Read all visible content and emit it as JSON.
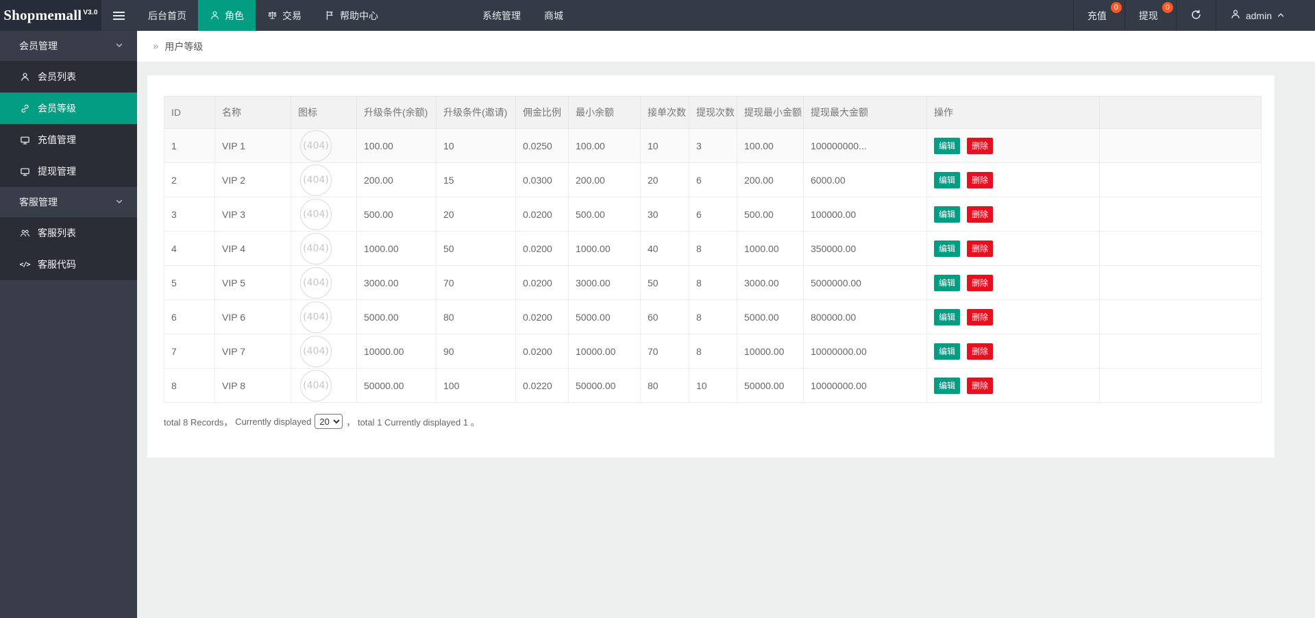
{
  "brand": {
    "name": "Shopmemall",
    "version": "V3.0"
  },
  "topnav": {
    "items": [
      {
        "label": "后台首页",
        "icon": null,
        "active": false
      },
      {
        "label": "角色",
        "icon": "person",
        "active": true
      },
      {
        "label": "交易",
        "icon": "scales",
        "active": false
      },
      {
        "label": "帮助中心",
        "icon": "flag",
        "active": false
      },
      {
        "label": "系统管理",
        "icon": null,
        "active": false
      },
      {
        "label": "商城",
        "icon": null,
        "active": false
      }
    ],
    "right_items": [
      {
        "label": "充值",
        "badge": "0"
      },
      {
        "label": "提现",
        "badge": "0"
      }
    ],
    "user": "admin"
  },
  "sidebar": {
    "groups": [
      {
        "label": "会员管理",
        "items": [
          {
            "label": "会员列表",
            "icon": "user",
            "active": false
          },
          {
            "label": "会员等级",
            "icon": "link",
            "active": true
          },
          {
            "label": "充值管理",
            "icon": "card",
            "active": false
          },
          {
            "label": "提现管理",
            "icon": "card",
            "active": false
          }
        ]
      },
      {
        "label": "客服管理",
        "items": [
          {
            "label": "客服列表",
            "icon": "users",
            "active": false
          },
          {
            "label": "客服代码",
            "icon": "code",
            "active": false
          }
        ]
      }
    ]
  },
  "breadcrumb": {
    "separator": "»",
    "title": "用户等级"
  },
  "table": {
    "columns": [
      "ID",
      "名称",
      "图标",
      "升级条件(余额)",
      "升级条件(邀请)",
      "佣金比例",
      "最小余额",
      "接单次数",
      "提现次数",
      "提现最小金额",
      "提现最大金额",
      "操作"
    ],
    "icon_placeholder": "(404)",
    "actions": {
      "edit": "编辑",
      "delete": "删除"
    },
    "rows": [
      {
        "id": "1",
        "name": "VIP 1",
        "upgrade_balance": "100.00",
        "upgrade_invite": "10",
        "commission": "0.0250",
        "min_balance": "100.00",
        "order_count": "10",
        "withdraw_count": "3",
        "withdraw_min": "100.00",
        "withdraw_max": "100000000..."
      },
      {
        "id": "2",
        "name": "VIP 2",
        "upgrade_balance": "200.00",
        "upgrade_invite": "15",
        "commission": "0.0300",
        "min_balance": "200.00",
        "order_count": "20",
        "withdraw_count": "6",
        "withdraw_min": "200.00",
        "withdraw_max": "6000.00"
      },
      {
        "id": "3",
        "name": "VIP 3",
        "upgrade_balance": "500.00",
        "upgrade_invite": "20",
        "commission": "0.0200",
        "min_balance": "500.00",
        "order_count": "30",
        "withdraw_count": "6",
        "withdraw_min": "500.00",
        "withdraw_max": "100000.00"
      },
      {
        "id": "4",
        "name": "VIP 4",
        "upgrade_balance": "1000.00",
        "upgrade_invite": "50",
        "commission": "0.0200",
        "min_balance": "1000.00",
        "order_count": "40",
        "withdraw_count": "8",
        "withdraw_min": "1000.00",
        "withdraw_max": "350000.00"
      },
      {
        "id": "5",
        "name": "VIP 5",
        "upgrade_balance": "3000.00",
        "upgrade_invite": "70",
        "commission": "0.0200",
        "min_balance": "3000.00",
        "order_count": "50",
        "withdraw_count": "8",
        "withdraw_min": "3000.00",
        "withdraw_max": "5000000.00"
      },
      {
        "id": "6",
        "name": "VIP 6",
        "upgrade_balance": "5000.00",
        "upgrade_invite": "80",
        "commission": "0.0200",
        "min_balance": "5000.00",
        "order_count": "60",
        "withdraw_count": "8",
        "withdraw_min": "5000.00",
        "withdraw_max": "800000.00"
      },
      {
        "id": "7",
        "name": "VIP 7",
        "upgrade_balance": "10000.00",
        "upgrade_invite": "90",
        "commission": "0.0200",
        "min_balance": "10000.00",
        "order_count": "70",
        "withdraw_count": "8",
        "withdraw_min": "10000.00",
        "withdraw_max": "10000000.00"
      },
      {
        "id": "8",
        "name": "VIP 8",
        "upgrade_balance": "50000.00",
        "upgrade_invite": "100",
        "commission": "0.0220",
        "min_balance": "50000.00",
        "order_count": "80",
        "withdraw_count": "10",
        "withdraw_min": "50000.00",
        "withdraw_max": "10000000.00"
      }
    ]
  },
  "footer": {
    "text_left": "total 8 Records，",
    "text_mid": "Currently displayed",
    "page_size": "20",
    "page_size_options": [
      "20"
    ],
    "text_right": "，  total 1 Currently displayed 1 。"
  },
  "colors": {
    "accent": "#029d82",
    "danger": "#e7101f",
    "badge": "#ff5722",
    "header-bg": "#343a46",
    "logo-bg": "#262c38",
    "side-bg": "#393d49",
    "side-child-bg": "#2a2d36"
  }
}
